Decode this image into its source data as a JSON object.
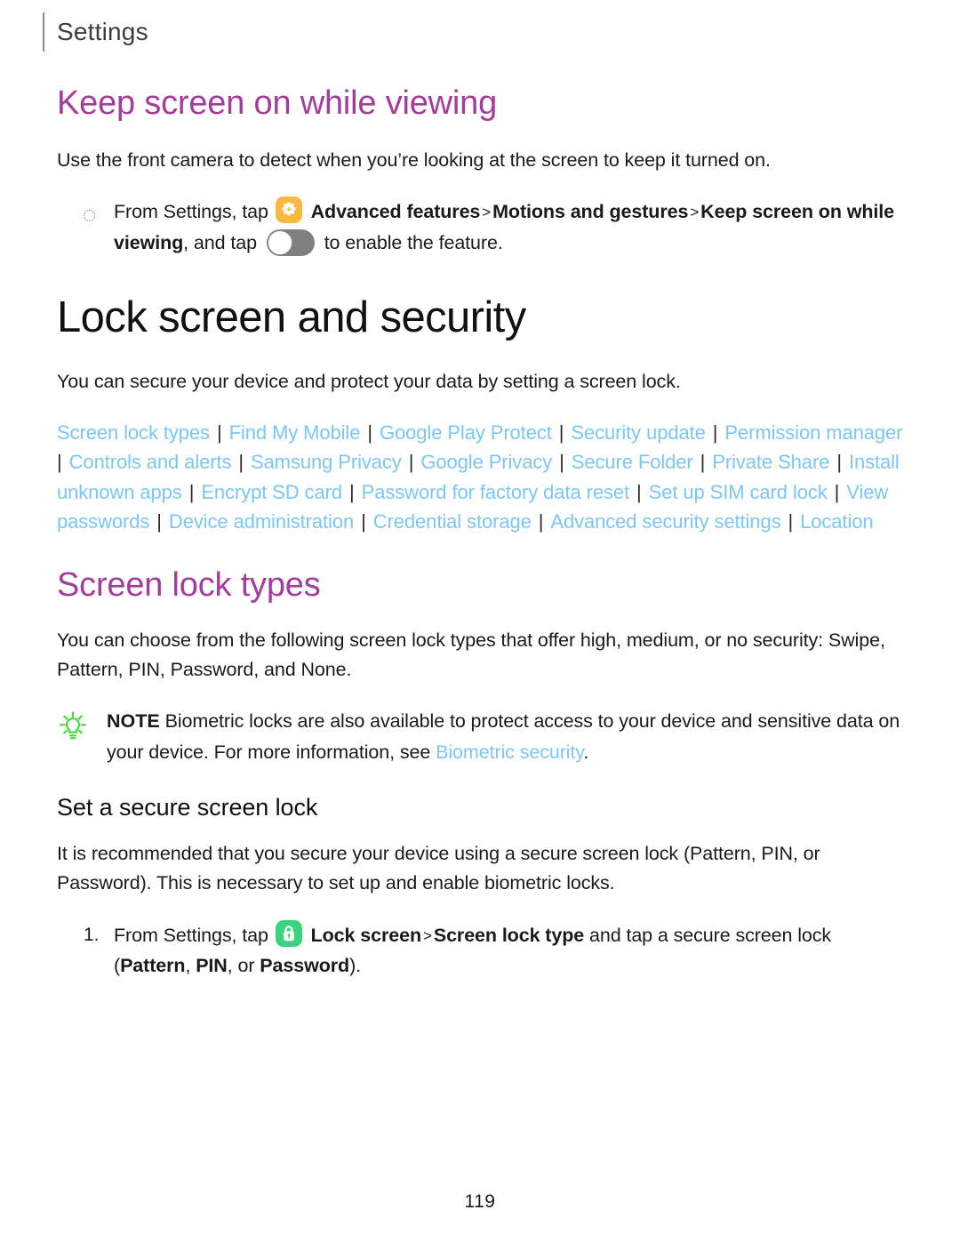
{
  "header": {
    "title": "Settings"
  },
  "sections": {
    "keep_screen": {
      "title": "Keep screen on while viewing",
      "intro": "Use the front camera to detect when you’re looking at the screen to keep it turned on.",
      "step": {
        "prefix": "From Settings, tap",
        "bold1": "Advanced features",
        "chev1": ">",
        "bold2": "Motions and gestures",
        "chev2": ">",
        "bold3": "Keep screen on while viewing",
        "mid": ", and tap",
        "suffix": "to enable the feature.",
        "icon": "advanced-features-icon",
        "toggle_state": "off"
      }
    },
    "lock_screen_security": {
      "title": "Lock screen and security",
      "intro": "You can secure your device and protect your data by setting a screen lock.",
      "links": [
        "Screen lock types",
        "Find My Mobile",
        "Google Play Protect",
        "Security update",
        "Permission manager",
        "Controls and alerts",
        "Samsung Privacy",
        "Google Privacy",
        "Secure Folder",
        "Private Share",
        "Install unknown apps",
        "Encrypt SD card",
        "Password for factory data reset",
        "Set up SIM card lock",
        "View passwords",
        "Device administration",
        "Credential storage",
        "Advanced security settings",
        "Location"
      ],
      "link_separator": "|"
    },
    "screen_lock_types": {
      "title": "Screen lock types",
      "body": "You can choose from the following screen lock types that offer high, medium, or no security: Swipe, Pattern, PIN, Password, and None.",
      "note": {
        "label": "NOTE",
        "text_before_link": "Biometric locks are also available to protect access to your device and sensitive data on your device. For more information, see ",
        "link": "Biometric security",
        "text_after_link": ".",
        "icon": "lightbulb-icon"
      }
    },
    "set_secure_lock": {
      "title": "Set a secure screen lock",
      "body": "It is recommended that you secure your device using a secure screen lock (Pattern, PIN, or Password). This is necessary to set up and enable biometric locks.",
      "step": {
        "number": "1.",
        "prefix": "From Settings, tap",
        "bold1": "Lock screen",
        "chev1": ">",
        "bold2": "Screen lock type",
        "mid": "and tap a secure screen lock (",
        "bold3": "Pattern",
        "sep1": ", ",
        "bold4": "PIN",
        "sep2": ", or ",
        "bold5": "Password",
        "suffix": ").",
        "icon": "lock-screen-icon"
      }
    }
  },
  "footer": {
    "page_number": "119"
  },
  "colors": {
    "heading_purple": "#a53c9b",
    "link_blue": "#7ac7f5",
    "note_green": "#3ddc2f",
    "icon_amber": "#f8b93f",
    "icon_green": "#3ad47f",
    "body_text": "#1a1a1a"
  }
}
